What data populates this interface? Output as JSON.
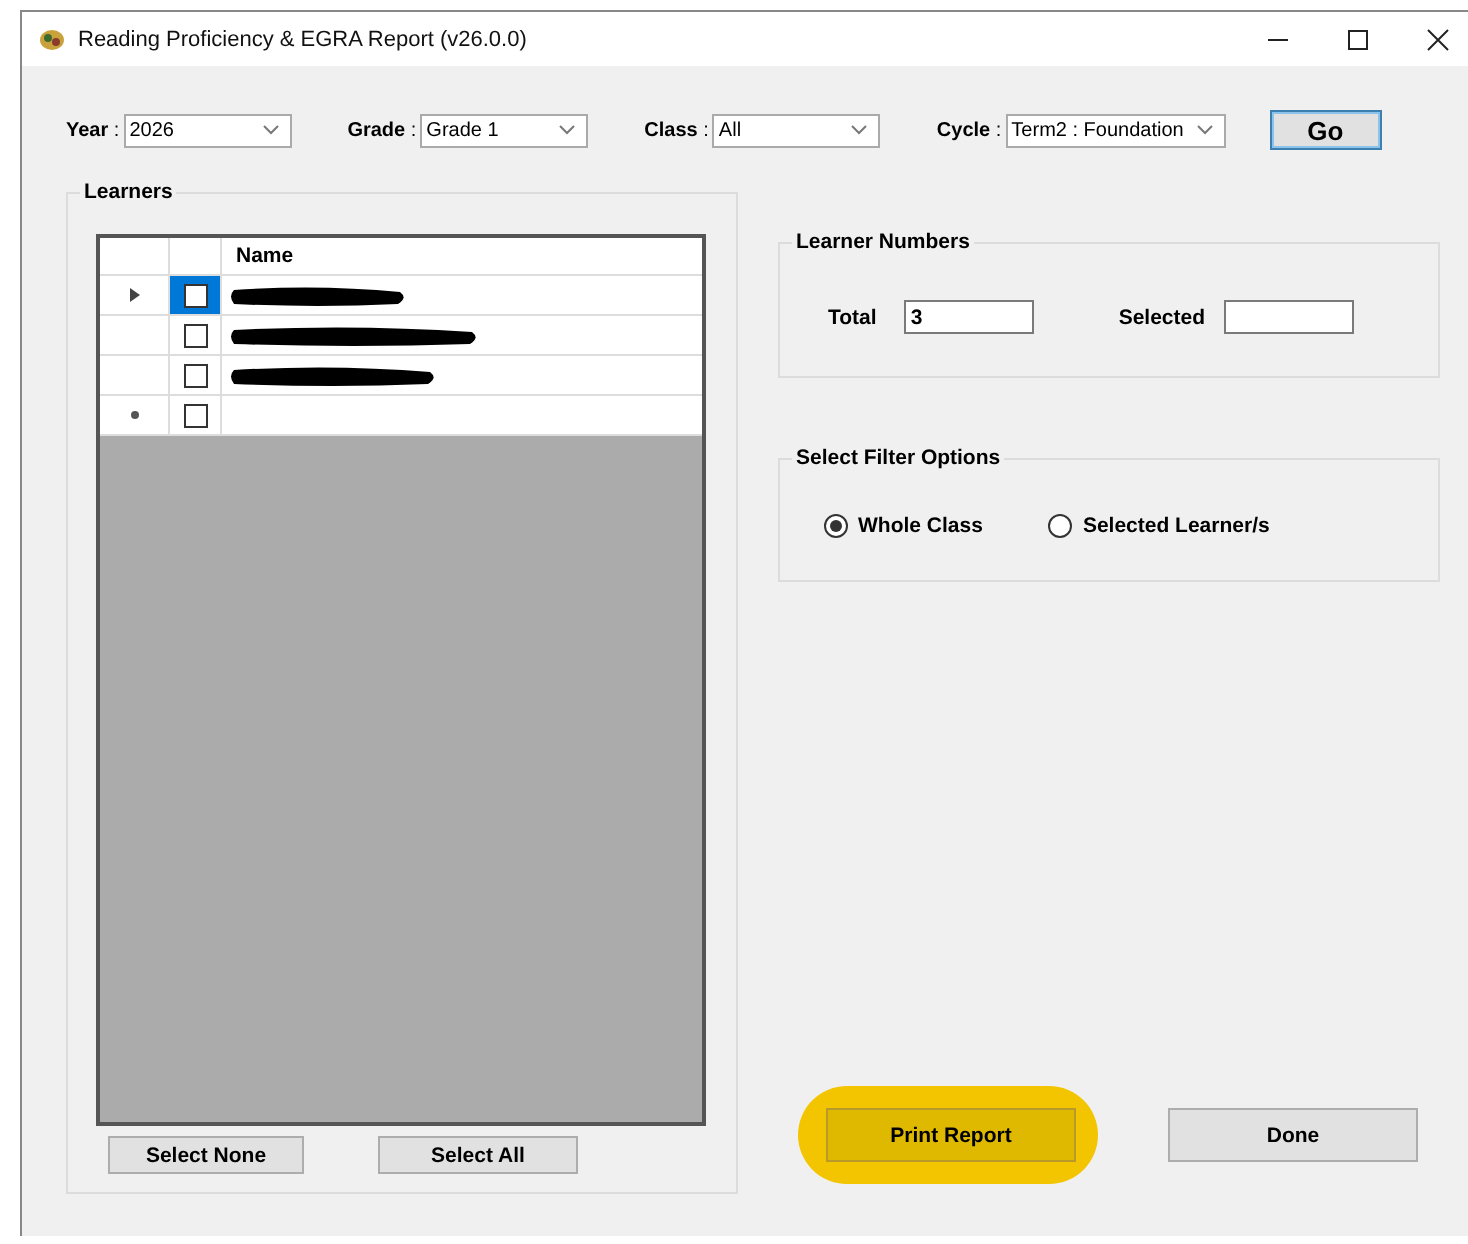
{
  "window": {
    "title": "Reading Proficiency & EGRA Report (v26.0.0)"
  },
  "filters": [
    {
      "label": "**Year** :",
      "value": "2026"
    },
    {
      "label": "**Grade** :",
      "value": "Grade 1"
    },
    {
      "label": "**Class** :",
      "value": "All"
    },
    {
      "label": "**Cycle** :",
      "value": "Term2 : Foundation"
    }
  ],
  "go_button": "Go",
  "learners": {
    "title": "Learners",
    "columns": [
      "Name"
    ],
    "rows": [
      {
        "kind": "redacted",
        "current": true,
        "selected": true,
        "checked": false
      },
      {
        "kind": "redacted",
        "current": false,
        "selected": false,
        "checked": false
      },
      {
        "kind": "redacted",
        "current": false,
        "selected": false,
        "checked": false
      },
      {
        "kind": "new",
        "current": false,
        "selected": false,
        "checked": false
      }
    ],
    "buttons": [
      "Select None",
      "Select All"
    ]
  },
  "learner_numbers": {
    "title": "Learner Numbers",
    "fields": [
      {
        "label": "Total",
        "value": "3"
      },
      {
        "label": "Selected"
      }
    ]
  },
  "filter_options": {
    "title": "Select Filter Options",
    "options": [
      {
        "label": "Whole Class",
        "selected": true
      },
      {
        "label": "Selected Learner/s",
        "selected": false
      }
    ]
  },
  "actions": [
    {
      "label": "Print Report",
      "highlighted": true
    },
    {
      "label": "Done",
      "highlighted": false
    }
  ]
}
